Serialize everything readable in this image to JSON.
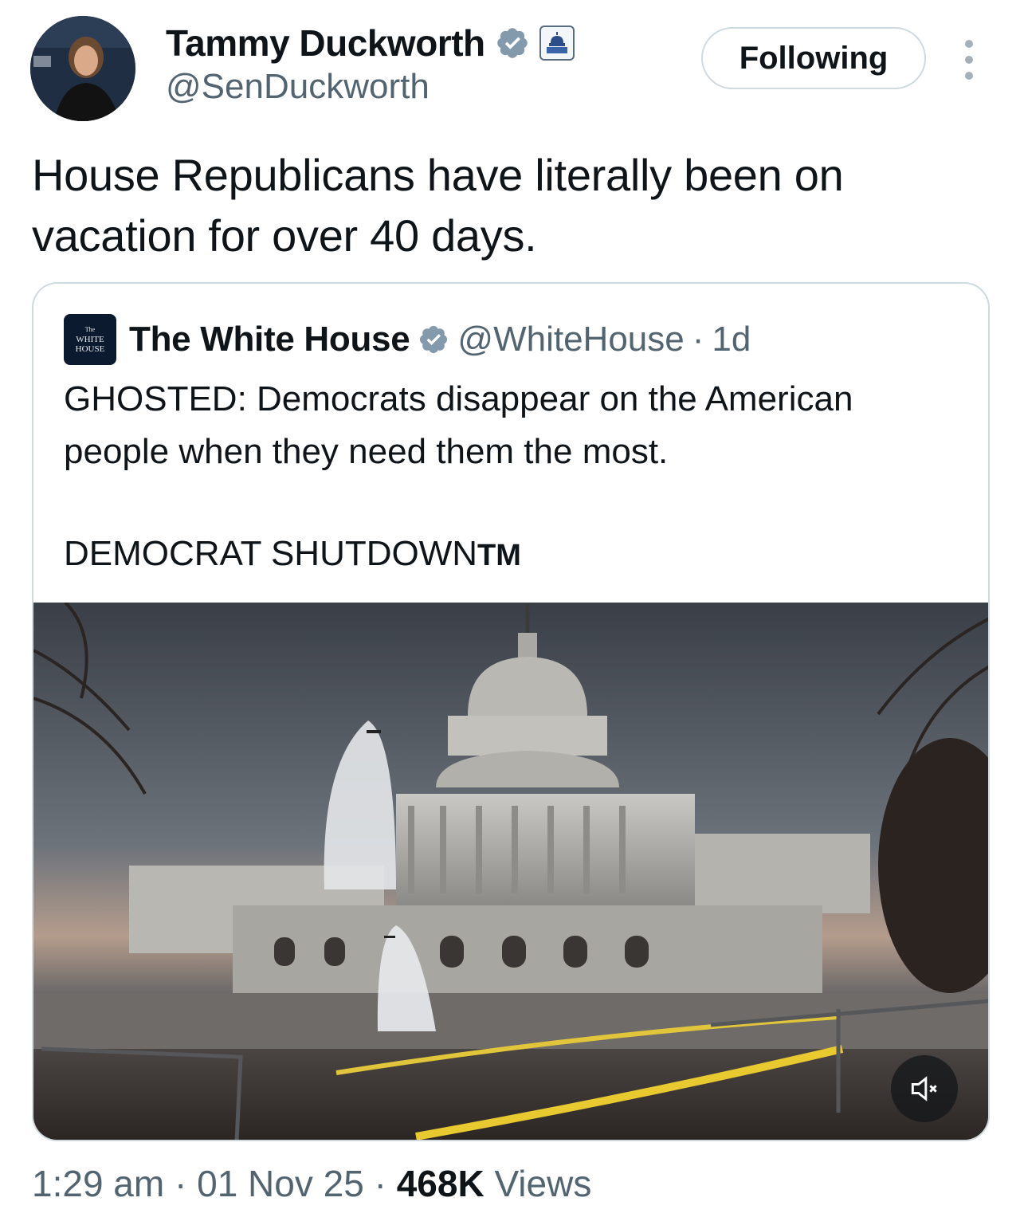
{
  "author": {
    "name": "Tammy Duckworth",
    "handle": "@SenDuckworth",
    "verified_icon": "verified-badge-icon",
    "affiliation_icon": "capitol-government-icon",
    "avatar_icon": "profile-photo-avatar"
  },
  "follow_button": {
    "label": "Following"
  },
  "more_icon": "more-vertical-icon",
  "tweet": {
    "text": "House Republicans have literally been on vacation for over 40 days."
  },
  "quoted": {
    "name": "The White House",
    "handle": "@WhiteHouse",
    "separator": "·",
    "age": "1d",
    "logo_text": [
      "The",
      "WHITE",
      "HOUSE"
    ],
    "text": "GHOSTED: Democrats disappear on the American people when they need them the most.",
    "text2": "DEMOCRAT SHUTDOWN",
    "trademark": "TM",
    "media_icon": "video-capitol-ghosts-thumbnail",
    "mute_icon": "volume-muted-icon"
  },
  "meta": {
    "time": "1:29 am",
    "sep1": "·",
    "date": "01 Nov 25",
    "sep2": "·",
    "views_count": "468K",
    "views_label": "Views"
  },
  "colors": {
    "text_primary": "#0f1419",
    "text_secondary": "#536471",
    "border": "#cfd9de",
    "verified_blue": "#1d9bf0"
  }
}
